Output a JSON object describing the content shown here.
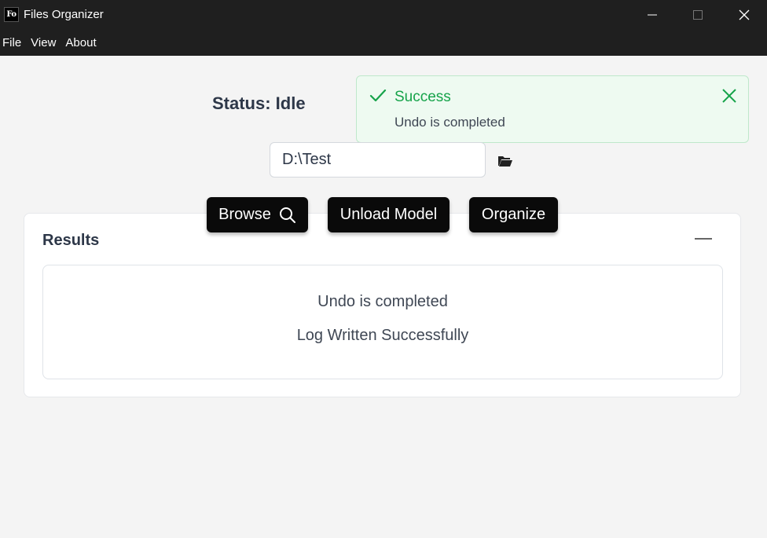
{
  "window": {
    "app_icon_text": "Fo",
    "title": "Files Organizer"
  },
  "menu": [
    "File",
    "View",
    "About"
  ],
  "status": {
    "text": "Status: Idle"
  },
  "toast": {
    "title": "Success",
    "message": "Undo is completed",
    "accent_color": "#16a34a"
  },
  "path_input": {
    "value": "D:\\Test"
  },
  "buttons": {
    "browse": "Browse",
    "unload": "Unload Model",
    "organize": "Organize"
  },
  "results": {
    "title": "Results",
    "lines": [
      "Undo is completed",
      "Log Written Successfully"
    ]
  }
}
